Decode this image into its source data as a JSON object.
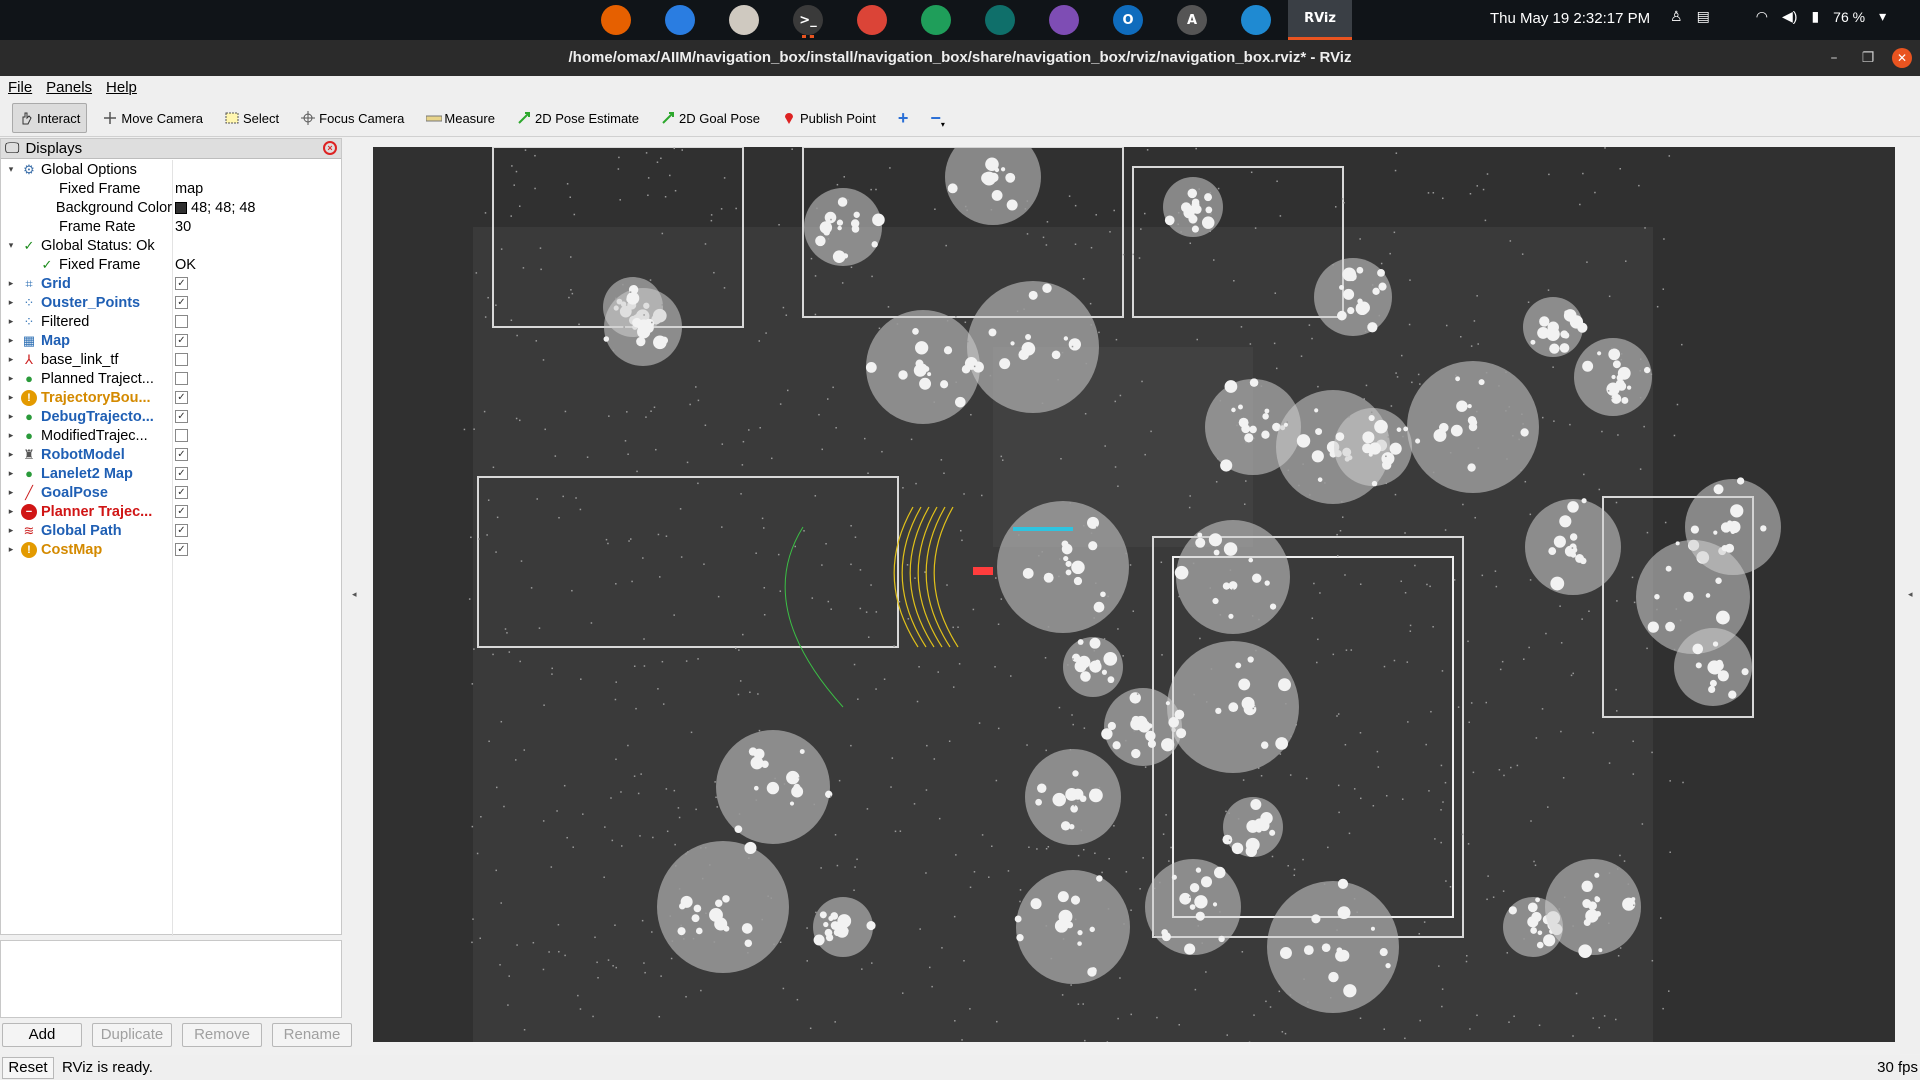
{
  "system": {
    "clock": "Thu May 19   2:32:17 PM",
    "battery": "76 %",
    "dock_apps": [
      {
        "name": "firefox",
        "color": "#e66000",
        "glyph": ""
      },
      {
        "name": "thunderbird",
        "color": "#2a7de1",
        "glyph": ""
      },
      {
        "name": "files",
        "color": "#cfc9c0",
        "glyph": ""
      },
      {
        "name": "terminal",
        "color": "#3a3a3a",
        "glyph": ">_"
      },
      {
        "name": "chrome",
        "color": "#db4437",
        "glyph": ""
      },
      {
        "name": "edge-dev",
        "color": "#1f9e5a",
        "glyph": ""
      },
      {
        "name": "gitkraken",
        "color": "#0f6f6a",
        "glyph": ""
      },
      {
        "name": "github-desktop",
        "color": "#7e4db4",
        "glyph": ""
      },
      {
        "name": "outlook",
        "color": "#0f6cbd",
        "glyph": "O"
      },
      {
        "name": "software-updater",
        "color": "#555555",
        "glyph": "A"
      },
      {
        "name": "vscode",
        "color": "#1f8ad2",
        "glyph": ""
      },
      {
        "name": "rviz",
        "color": "#3a3f45",
        "glyph": "RViz"
      }
    ]
  },
  "window": {
    "title": "/home/omax/AIIM/navigation_box/install/navigation_box/share/navigation_box/rviz/navigation_box.rviz* - RViz"
  },
  "menu": [
    "File",
    "Panels",
    "Help"
  ],
  "toolbar": [
    {
      "label": "Interact",
      "icon": "hand-icon",
      "active": true
    },
    {
      "label": "Move Camera",
      "icon": "move-icon",
      "active": false
    },
    {
      "label": "Select",
      "icon": "select-icon",
      "active": false
    },
    {
      "label": "Focus Camera",
      "icon": "focus-icon",
      "active": false
    },
    {
      "label": "Measure",
      "icon": "ruler-icon",
      "active": false
    },
    {
      "label": "2D Pose Estimate",
      "icon": "pose-arrow-icon",
      "active": false
    },
    {
      "label": "2D Goal Pose",
      "icon": "goal-arrow-icon",
      "active": false
    },
    {
      "label": "Publish Point",
      "icon": "map-pin-icon",
      "active": false
    }
  ],
  "displays": {
    "title": "Displays",
    "rows": [
      {
        "indent": 0,
        "arrow": "▾",
        "icon": "gear",
        "name": "Global Options",
        "value": "",
        "checkbox": null,
        "color": "#000"
      },
      {
        "indent": 1,
        "arrow": "",
        "icon": "",
        "name": "Fixed Frame",
        "value": "map",
        "checkbox": null,
        "color": "#000"
      },
      {
        "indent": 1,
        "arrow": "",
        "icon": "",
        "name": "Background Color",
        "value": "48; 48; 48",
        "swatch": "#303030",
        "checkbox": null,
        "color": "#000"
      },
      {
        "indent": 1,
        "arrow": "",
        "icon": "",
        "name": "Frame Rate",
        "value": "30",
        "checkbox": null,
        "color": "#000"
      },
      {
        "indent": 0,
        "arrow": "▾",
        "icon": "check",
        "name": "Global Status: Ok",
        "value": "",
        "checkbox": null,
        "color": "#000"
      },
      {
        "indent": 1,
        "arrow": "",
        "icon": "check",
        "name": "Fixed Frame",
        "value": "OK",
        "checkbox": null,
        "color": "#000"
      },
      {
        "indent": 0,
        "arrow": "▸",
        "icon": "grid",
        "name": "Grid",
        "value": "",
        "checkbox": true,
        "color": "#1f5fb4"
      },
      {
        "indent": 0,
        "arrow": "▸",
        "icon": "points",
        "name": "Ouster_Points",
        "value": "",
        "checkbox": true,
        "color": "#1f5fb4"
      },
      {
        "indent": 0,
        "arrow": "▸",
        "icon": "points",
        "name": "Filtered",
        "value": "",
        "checkbox": false,
        "color": "#000"
      },
      {
        "indent": 0,
        "arrow": "▸",
        "icon": "map",
        "name": "Map",
        "value": "",
        "checkbox": true,
        "color": "#1f5fb4"
      },
      {
        "indent": 0,
        "arrow": "▸",
        "icon": "tf",
        "name": "base_link_tf",
        "value": "",
        "checkbox": false,
        "color": "#000"
      },
      {
        "indent": 0,
        "arrow": "▸",
        "icon": "markers",
        "name": "Planned Traject...",
        "value": "",
        "checkbox": false,
        "color": "#000"
      },
      {
        "indent": 0,
        "arrow": "▸",
        "icon": "warn",
        "name": "TrajectoryBou...",
        "value": "",
        "checkbox": true,
        "color": "#d48a00"
      },
      {
        "indent": 0,
        "arrow": "▸",
        "icon": "markers",
        "name": "DebugTrajecto...",
        "value": "",
        "checkbox": true,
        "color": "#1f5fb4"
      },
      {
        "indent": 0,
        "arrow": "▸",
        "icon": "markers",
        "name": "ModifiedTrajec...",
        "value": "",
        "checkbox": false,
        "color": "#000"
      },
      {
        "indent": 0,
        "arrow": "▸",
        "icon": "robot",
        "name": "RobotModel",
        "value": "",
        "checkbox": true,
        "color": "#1f5fb4"
      },
      {
        "indent": 0,
        "arrow": "▸",
        "icon": "markers",
        "name": "Lanelet2 Map",
        "value": "",
        "checkbox": true,
        "color": "#1f5fb4"
      },
      {
        "indent": 0,
        "arrow": "▸",
        "icon": "pose",
        "name": "GoalPose",
        "value": "",
        "checkbox": true,
        "color": "#1f5fb4"
      },
      {
        "indent": 0,
        "arrow": "▸",
        "icon": "error",
        "name": "Planner Trajec...",
        "value": "",
        "checkbox": true,
        "color": "#d01515"
      },
      {
        "indent": 0,
        "arrow": "▸",
        "icon": "path",
        "name": "Global Path",
        "value": "",
        "checkbox": true,
        "color": "#1f5fb4"
      },
      {
        "indent": 0,
        "arrow": "▸",
        "icon": "warn",
        "name": "CostMap",
        "value": "",
        "checkbox": true,
        "color": "#d48a00"
      }
    ]
  },
  "panel_buttons": {
    "add": "Add",
    "duplicate": "Duplicate",
    "remove": "Remove",
    "rename": "Rename"
  },
  "status": {
    "reset": "Reset",
    "message": "RViz is ready.",
    "fps": "30 fps"
  }
}
